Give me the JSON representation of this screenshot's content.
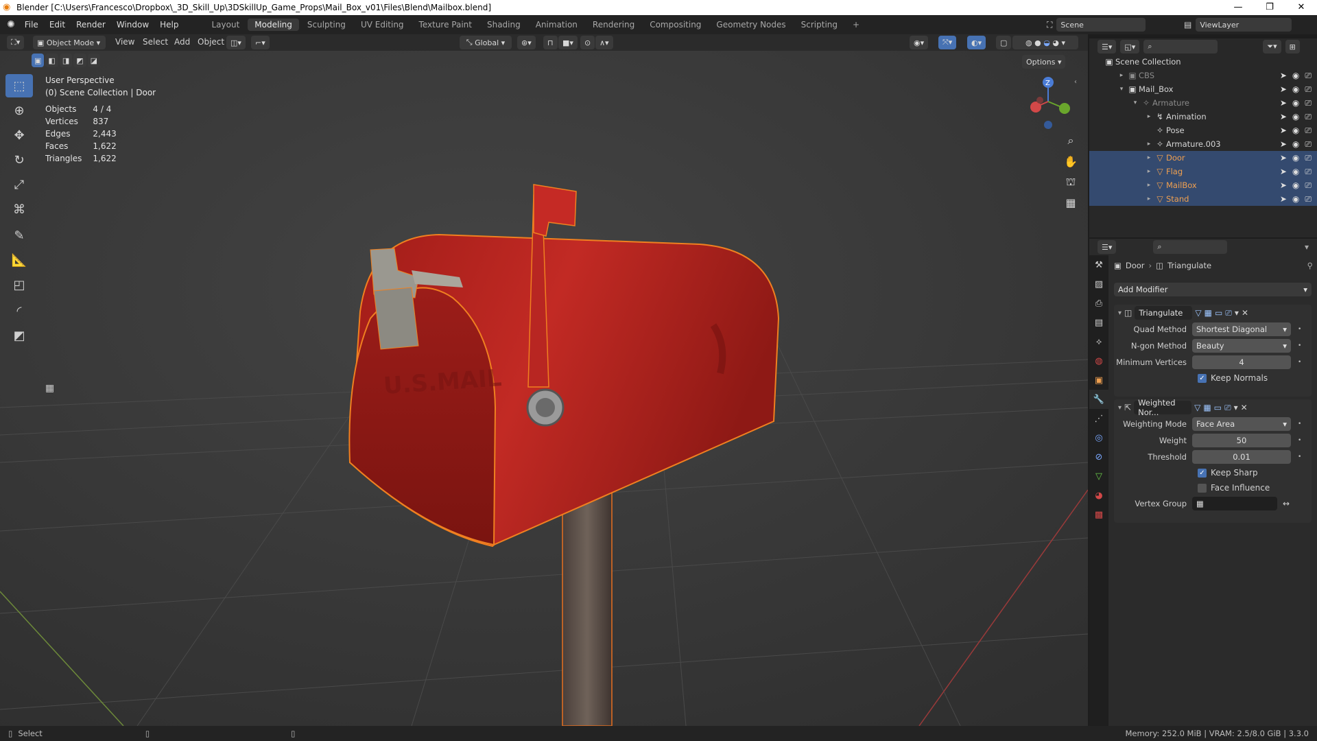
{
  "titlebar": {
    "title": "Blender [C:\\Users\\Francesco\\Dropbox\\_3D_Skill_Up\\3DSkillUp_Game_Props\\Mail_Box_v01\\Files\\Blend\\Mailbox.blend]",
    "min": "—",
    "max": "❐",
    "close": "✕"
  },
  "menus": [
    "File",
    "Edit",
    "Render",
    "Window",
    "Help"
  ],
  "workspaces": [
    "Layout",
    "Modeling",
    "Sculpting",
    "UV Editing",
    "Texture Paint",
    "Shading",
    "Animation",
    "Rendering",
    "Compositing",
    "Geometry Nodes",
    "Scripting",
    "+"
  ],
  "active_workspace": "Modeling",
  "scene": {
    "label": "Scene",
    "viewlayer": "ViewLayer"
  },
  "header": {
    "mode": "Object Mode",
    "view": "View",
    "select": "Select",
    "add": "Add",
    "object": "Object",
    "orientation": "Global",
    "options": "Options"
  },
  "overlay": {
    "perspective": "User Perspective",
    "collection": "(0) Scene Collection | Door",
    "stats": [
      {
        "label": "Objects",
        "value": "4 / 4"
      },
      {
        "label": "Vertices",
        "value": "837"
      },
      {
        "label": "Edges",
        "value": "2,443"
      },
      {
        "label": "Faces",
        "value": "1,622"
      },
      {
        "label": "Triangles",
        "value": "1,622"
      }
    ]
  },
  "gizmo": {
    "z": "Z"
  },
  "outliner": {
    "root": "Scene Collection",
    "rows": [
      {
        "name": "CBS",
        "level": 1,
        "icon": "▣",
        "color": "#8a8a8a",
        "arrow": "▸",
        "hl": false
      },
      {
        "name": "Mail_Box",
        "level": 1,
        "icon": "▣",
        "color": "#d6d6d6",
        "arrow": "▾",
        "hl": false
      },
      {
        "name": "Armature",
        "level": 2,
        "icon": "✧",
        "color": "#8a8a8a",
        "arrow": "▾",
        "hl": false
      },
      {
        "name": "Animation",
        "level": 3,
        "icon": "↯",
        "color": "#d6d6d6",
        "arrow": "▸",
        "hl": false
      },
      {
        "name": "Pose",
        "level": 3,
        "icon": "✧",
        "color": "#d6d6d6",
        "arrow": "",
        "hl": false
      },
      {
        "name": "Armature.003",
        "level": 3,
        "icon": "✧",
        "color": "#d6d6d6",
        "arrow": "▸",
        "hl": false
      },
      {
        "name": "Door",
        "level": 3,
        "icon": "▽",
        "color": "#f0a050",
        "arrow": "▸",
        "hl": true
      },
      {
        "name": "Flag",
        "level": 3,
        "icon": "▽",
        "color": "#f0a050",
        "arrow": "▸",
        "hl": true
      },
      {
        "name": "MailBox",
        "level": 3,
        "icon": "▽",
        "color": "#f0a050",
        "arrow": "▸",
        "hl": true
      },
      {
        "name": "Stand",
        "level": 3,
        "icon": "▽",
        "color": "#f0a050",
        "arrow": "▸",
        "hl": true
      }
    ]
  },
  "properties": {
    "breadcrumb_object": "Door",
    "breadcrumb_modifier": "Triangulate",
    "add_modifier": "Add Modifier",
    "triangulate": {
      "name": "Triangulate",
      "fields": [
        {
          "label": "Quad Method",
          "value": "Shortest Diagonal",
          "type": "dropdown"
        },
        {
          "label": "N-gon Method",
          "value": "Beauty",
          "type": "dropdown"
        },
        {
          "label": "Minimum Vertices",
          "value": "4",
          "type": "number"
        }
      ],
      "checks": [
        {
          "label": "Keep Normals",
          "checked": true
        }
      ]
    },
    "weighted": {
      "name": "Weighted Nor...",
      "fields": [
        {
          "label": "Weighting Mode",
          "value": "Face Area",
          "type": "dropdown"
        },
        {
          "label": "Weight",
          "value": "50",
          "type": "number"
        },
        {
          "label": "Threshold",
          "value": "0.01",
          "type": "number"
        }
      ],
      "checks": [
        {
          "label": "Keep Sharp",
          "checked": true
        },
        {
          "label": "Face Influence",
          "checked": false
        }
      ],
      "vertex_group_label": "Vertex Group"
    }
  },
  "statusbar": {
    "left": "Select",
    "right": "Memory: 252.0 MiB | VRAM: 2.5/8.0 GiB | 3.3.0"
  },
  "colors": {
    "accent": "#4772b3",
    "selection": "#f08020",
    "mailbox": "#b52320"
  }
}
